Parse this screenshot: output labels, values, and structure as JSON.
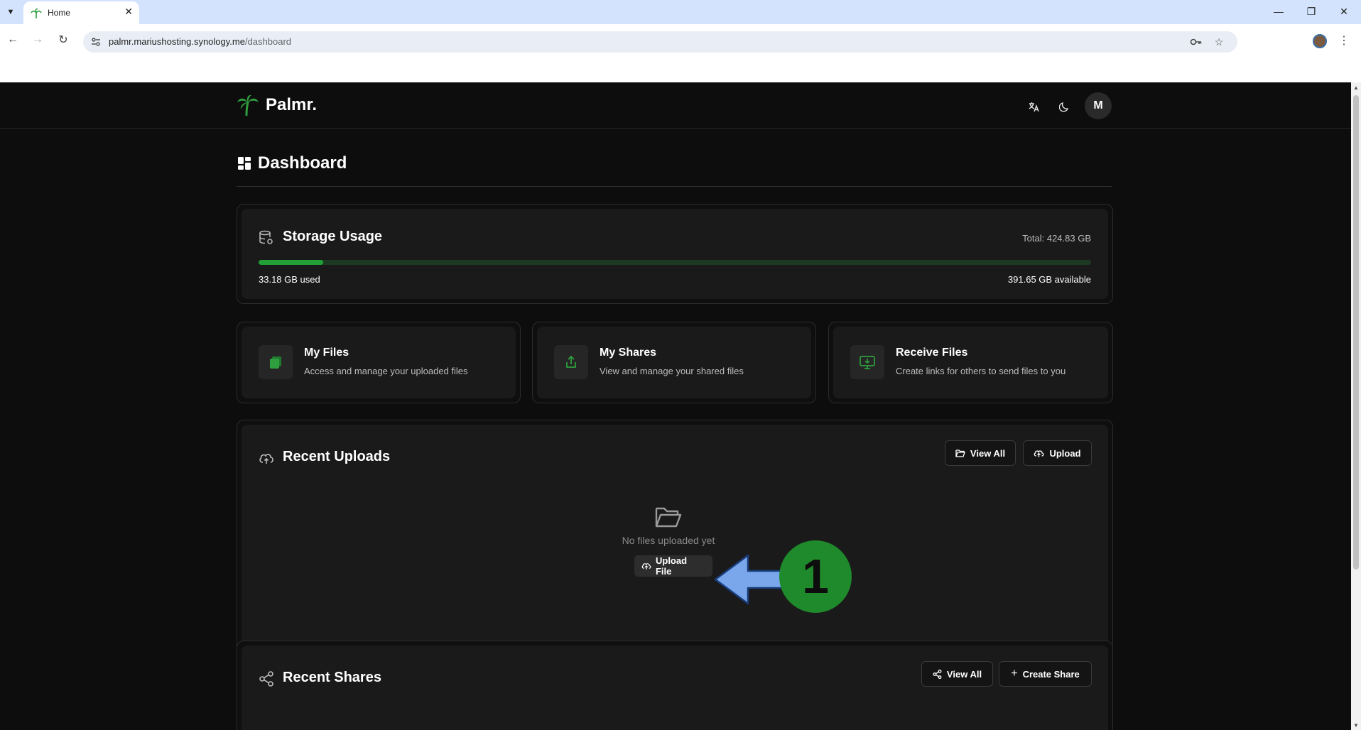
{
  "browser": {
    "tab_title": "Home",
    "url_host": "palmr.mariushosting.synology.me",
    "url_path": "/dashboard"
  },
  "app": {
    "brand": "Palmr.",
    "avatar_initial": "M",
    "page_title": "Dashboard",
    "accent_color": "#22a037"
  },
  "storage": {
    "title": "Storage Usage",
    "total": "Total: 424.83 GB",
    "used": "33.18 GB used",
    "available": "391.65 GB available",
    "used_fraction": 0.078
  },
  "quick_actions": [
    {
      "title": "My Files",
      "description": "Access and manage your uploaded files",
      "icon": "files-icon"
    },
    {
      "title": "My Shares",
      "description": "View and manage your shared files",
      "icon": "share-upload-icon"
    },
    {
      "title": "Receive Files",
      "description": "Create links for others to send files to you",
      "icon": "monitor-download-icon"
    }
  ],
  "recent_uploads": {
    "title": "Recent Uploads",
    "view_all": "View All",
    "upload": "Upload",
    "empty_text": "No files uploaded yet",
    "upload_file": "Upload File"
  },
  "recent_shares": {
    "title": "Recent Shares",
    "view_all": "View All",
    "create_share": "Create Share"
  },
  "annotation": {
    "step_number": "1",
    "badge_color": "#1f8a2b",
    "arrow_color": "#7aa7ec"
  }
}
